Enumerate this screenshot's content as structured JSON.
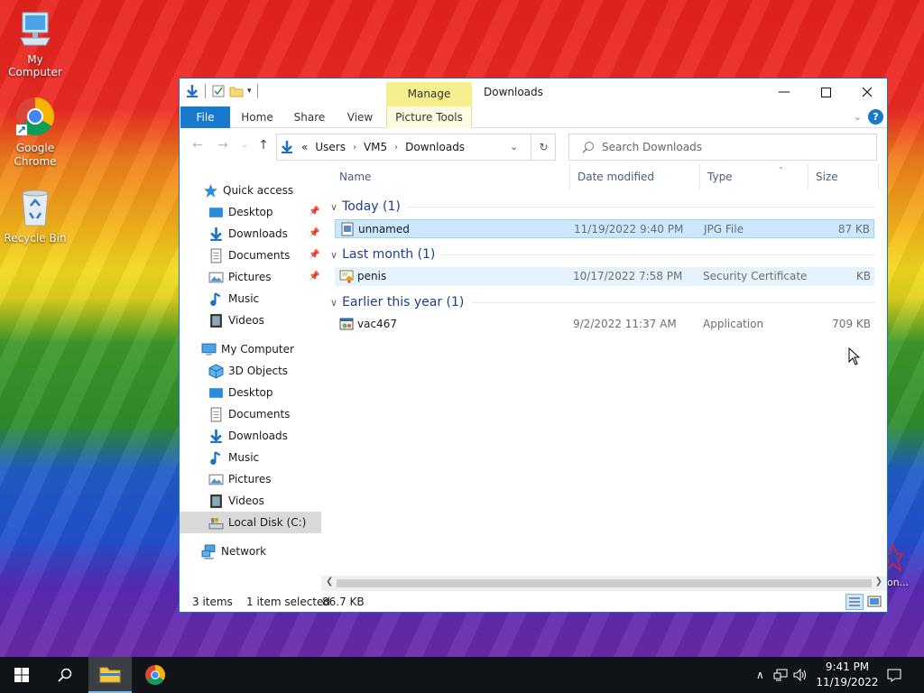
{
  "desktop": {
    "icons": [
      {
        "label": "My Computer"
      },
      {
        "label": "Google Chrome"
      },
      {
        "label": "Recycle Bin"
      }
    ],
    "stray_label": "gon..."
  },
  "window": {
    "title": "Downloads",
    "contextual_tab": "Manage",
    "ribbon_tabs": {
      "file": "File",
      "home": "Home",
      "share": "Share",
      "view": "View",
      "picture_tools": "Picture Tools"
    },
    "help": "?"
  },
  "address": {
    "overflow": "«",
    "segments": [
      "Users",
      "VM5",
      "Downloads"
    ],
    "search_placeholder": "Search Downloads"
  },
  "sidebar": {
    "quick_access": "Quick access",
    "quick_items": [
      {
        "label": "Desktop",
        "pinned": true
      },
      {
        "label": "Downloads",
        "pinned": true
      },
      {
        "label": "Documents",
        "pinned": true
      },
      {
        "label": "Pictures",
        "pinned": true
      },
      {
        "label": "Music",
        "pinned": false
      },
      {
        "label": "Videos",
        "pinned": false
      }
    ],
    "my_computer": "My Computer",
    "computer_items": [
      {
        "label": "3D Objects"
      },
      {
        "label": "Desktop"
      },
      {
        "label": "Documents"
      },
      {
        "label": "Downloads"
      },
      {
        "label": "Music"
      },
      {
        "label": "Pictures"
      },
      {
        "label": "Videos"
      },
      {
        "label": "Local Disk (C:)",
        "selected": true
      }
    ],
    "network": "Network"
  },
  "columns": {
    "name": "Name",
    "date": "Date modified",
    "type": "Type",
    "size": "Size"
  },
  "groups": [
    {
      "label": "Today (1)",
      "files": [
        {
          "name": "unnamed",
          "date": "11/19/2022 9:40 PM",
          "type": "JPG File",
          "size": "87 KB",
          "icon": "jpg-file-icon",
          "state": "selected"
        }
      ]
    },
    {
      "label": "Last month (1)",
      "files": [
        {
          "name": "penis",
          "date": "10/17/2022 7:58 PM",
          "type": "Security Certificate",
          "size": "KB",
          "icon": "certificate-icon",
          "state": "hover"
        }
      ]
    },
    {
      "label": "Earlier this year (1)",
      "files": [
        {
          "name": "vac467",
          "date": "9/2/2022 11:37 AM",
          "type": "Application",
          "size": "709 KB",
          "icon": "application-icon",
          "state": "normal"
        }
      ]
    }
  ],
  "status": {
    "items": "3 items",
    "selected": "1 item selected",
    "size": "86.7 KB"
  },
  "taskbar": {
    "time": "9:41 PM",
    "date": "11/19/2022"
  }
}
